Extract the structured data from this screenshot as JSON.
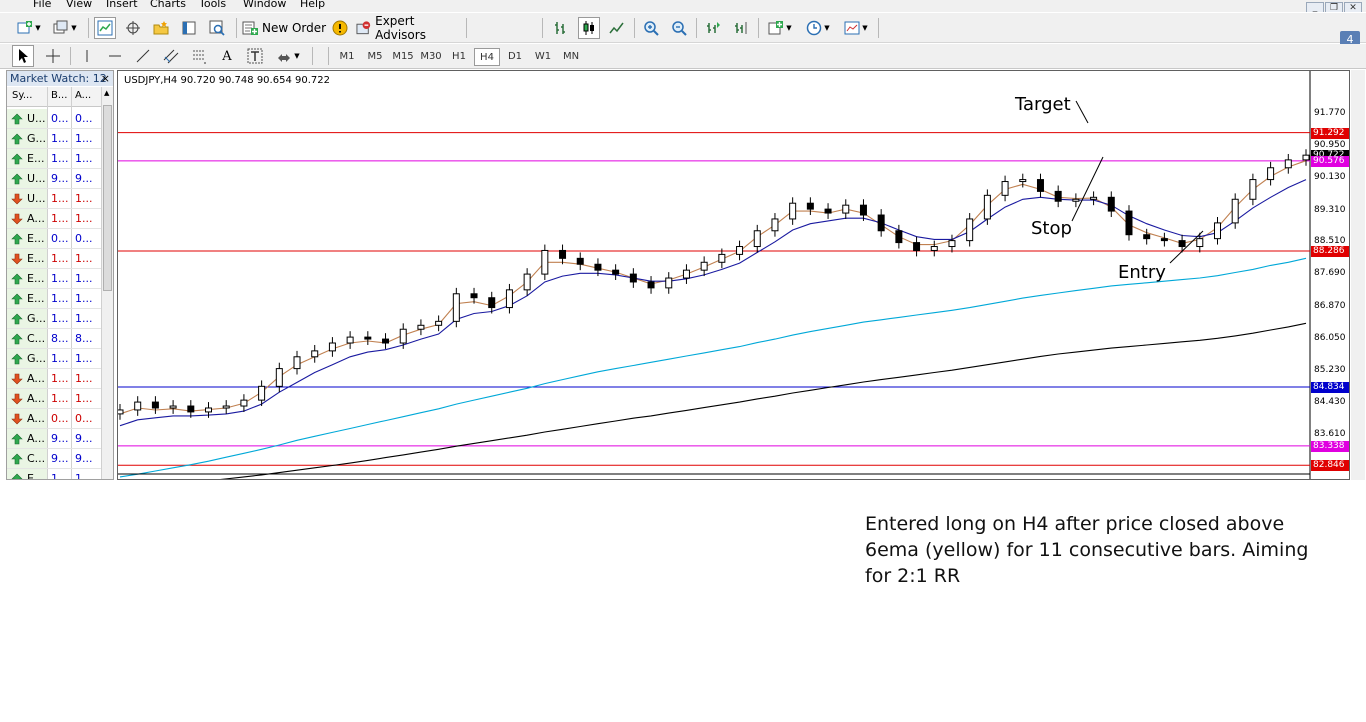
{
  "menu": [
    "File",
    "View",
    "Insert",
    "Charts",
    "Tools",
    "Window",
    "Help"
  ],
  "window_controls": [
    "_",
    "❐",
    "✕"
  ],
  "toolbar": {
    "new_order_label": "New Order",
    "expert_advisors_label": "Expert Advisors",
    "notification_count": "4"
  },
  "timeframes": [
    "M1",
    "M5",
    "M15",
    "M30",
    "H1",
    "H4",
    "D1",
    "W1",
    "MN"
  ],
  "active_timeframe": "H4",
  "market_watch": {
    "title": "Market Watch: 12",
    "close": "×",
    "columns": [
      "Sy...",
      "B...",
      "A..."
    ],
    "rows": [
      {
        "dir": "up",
        "symbol": "U...",
        "bid": "0...",
        "ask": "0...",
        "color": "#0000cc"
      },
      {
        "dir": "up",
        "symbol": "G...",
        "bid": "1...",
        "ask": "1...",
        "color": "#0000cc"
      },
      {
        "dir": "up",
        "symbol": "E...",
        "bid": "1...",
        "ask": "1...",
        "color": "#0000cc"
      },
      {
        "dir": "up",
        "symbol": "U...",
        "bid": "9...",
        "ask": "9...",
        "color": "#0000cc"
      },
      {
        "dir": "down",
        "symbol": "U...",
        "bid": "1...",
        "ask": "1...",
        "color": "#cc0000"
      },
      {
        "dir": "down",
        "symbol": "A...",
        "bid": "1...",
        "ask": "1...",
        "color": "#cc0000"
      },
      {
        "dir": "up",
        "symbol": "E...",
        "bid": "0...",
        "ask": "0...",
        "color": "#0000cc"
      },
      {
        "dir": "down",
        "symbol": "E...",
        "bid": "1...",
        "ask": "1...",
        "color": "#cc0000"
      },
      {
        "dir": "up",
        "symbol": "E...",
        "bid": "1...",
        "ask": "1...",
        "color": "#0000cc"
      },
      {
        "dir": "up",
        "symbol": "E...",
        "bid": "1...",
        "ask": "1...",
        "color": "#0000cc"
      },
      {
        "dir": "up",
        "symbol": "G...",
        "bid": "1...",
        "ask": "1...",
        "color": "#0000cc"
      },
      {
        "dir": "up",
        "symbol": "C...",
        "bid": "8...",
        "ask": "8...",
        "color": "#0000cc"
      },
      {
        "dir": "up",
        "symbol": "G...",
        "bid": "1...",
        "ask": "1...",
        "color": "#0000cc"
      },
      {
        "dir": "down",
        "symbol": "A...",
        "bid": "1...",
        "ask": "1...",
        "color": "#cc0000"
      },
      {
        "dir": "down",
        "symbol": "A...",
        "bid": "1...",
        "ask": "1...",
        "color": "#cc0000"
      },
      {
        "dir": "down",
        "symbol": "A...",
        "bid": "0...",
        "ask": "0...",
        "color": "#cc0000"
      },
      {
        "dir": "up",
        "symbol": "A...",
        "bid": "9...",
        "ask": "9...",
        "color": "#0000cc"
      },
      {
        "dir": "up",
        "symbol": "C...",
        "bid": "9...",
        "ask": "9...",
        "color": "#0000cc"
      },
      {
        "dir": "up",
        "symbol": "E...",
        "bid": "1...",
        "ask": "1...",
        "color": "#0000cc"
      }
    ]
  },
  "chart": {
    "header": "USDJPY,H4  90.720 90.748 90.654 90.722",
    "y_ticks": [
      "91.770",
      "90.950",
      "90.130",
      "89.310",
      "88.510",
      "87.690",
      "86.870",
      "86.050",
      "85.230",
      "84.430",
      "83.610"
    ],
    "price_labels": [
      {
        "value": "91.292",
        "color": "#e00000"
      },
      {
        "value": "90.722",
        "color": "#000000"
      },
      {
        "value": "90.576",
        "color": "#e000e0"
      },
      {
        "value": "88.286",
        "color": "#e00000"
      },
      {
        "value": "84.834",
        "color": "#0000cc"
      },
      {
        "value": "83.338",
        "color": "#e000e0"
      },
      {
        "value": "82.846",
        "color": "#e00000"
      }
    ],
    "annotations": {
      "target": "Target",
      "stop": "Stop",
      "entry": "Entry"
    }
  },
  "chart_data": {
    "type": "line",
    "title": "USDJPY,H4",
    "ylim": [
      82.7,
      92.4
    ],
    "series": [
      {
        "values": [
          84.25,
          84.45,
          84.3,
          84.35,
          84.2,
          84.3,
          84.35,
          84.5,
          84.85,
          85.3,
          85.6,
          85.75,
          85.95,
          86.1,
          86.05,
          85.95,
          86.3,
          86.4,
          86.5,
          87.2,
          87.1,
          86.85,
          87.3,
          87.7,
          88.3,
          88.1,
          87.95,
          87.8,
          87.7,
          87.5,
          87.35,
          87.6,
          87.8,
          88.0,
          88.2,
          88.4,
          88.8,
          89.1,
          89.5,
          89.35,
          89.25,
          89.45,
          89.2,
          88.8,
          88.5,
          88.3,
          88.4,
          88.55,
          89.1,
          89.7,
          90.05,
          90.1,
          89.8,
          89.55,
          89.6,
          89.65,
          89.3,
          88.7,
          88.6,
          88.55,
          88.4,
          88.6,
          89.0,
          89.6,
          90.1,
          90.4,
          90.6,
          90.72
        ]
      },
      {
        "values": [
          84.15,
          84.3,
          84.25,
          84.28,
          84.22,
          84.26,
          84.3,
          84.42,
          84.7,
          85.1,
          85.4,
          85.6,
          85.8,
          85.95,
          86.0,
          85.95,
          86.15,
          86.3,
          86.42,
          86.95,
          87.0,
          86.9,
          87.15,
          87.5,
          88.0,
          88.0,
          87.95,
          87.85,
          87.75,
          87.6,
          87.45,
          87.55,
          87.7,
          87.88,
          88.08,
          88.28,
          88.65,
          88.95,
          89.3,
          89.3,
          89.25,
          89.35,
          89.25,
          88.95,
          88.65,
          88.45,
          88.45,
          88.55,
          88.95,
          89.45,
          89.85,
          89.98,
          89.85,
          89.65,
          89.62,
          89.63,
          89.4,
          88.95,
          88.75,
          88.62,
          88.48,
          88.58,
          88.88,
          89.4,
          89.85,
          90.18,
          90.42,
          90.58
        ]
      },
      {
        "values": [
          83.85,
          84.0,
          84.05,
          84.1,
          84.1,
          84.12,
          84.15,
          84.22,
          84.4,
          84.7,
          84.95,
          85.2,
          85.4,
          85.6,
          85.72,
          85.78,
          85.9,
          86.05,
          86.18,
          86.55,
          86.7,
          86.75,
          86.9,
          87.15,
          87.5,
          87.65,
          87.72,
          87.72,
          87.68,
          87.6,
          87.52,
          87.52,
          87.58,
          87.68,
          87.82,
          87.98,
          88.25,
          88.52,
          88.82,
          88.98,
          89.05,
          89.12,
          89.12,
          89.0,
          88.82,
          88.65,
          88.58,
          88.58,
          88.78,
          89.1,
          89.4,
          89.6,
          89.65,
          89.6,
          89.58,
          89.58,
          89.45,
          89.18,
          88.98,
          88.82,
          88.68,
          88.65,
          88.75,
          89.05,
          89.38,
          89.65,
          89.9,
          90.1
        ]
      },
      {
        "values": [
          82.55,
          82.62,
          82.7,
          82.78,
          82.86,
          82.95,
          83.05,
          83.15,
          83.25,
          83.36,
          83.48,
          83.58,
          83.68,
          83.78,
          83.88,
          83.98,
          84.08,
          84.18,
          84.28,
          84.4,
          84.5,
          84.6,
          84.7,
          84.8,
          84.92,
          85.02,
          85.12,
          85.22,
          85.3,
          85.38,
          85.46,
          85.54,
          85.62,
          85.7,
          85.78,
          85.86,
          85.96,
          86.05,
          86.15,
          86.24,
          86.32,
          86.4,
          86.48,
          86.54,
          86.6,
          86.66,
          86.72,
          86.78,
          86.85,
          86.93,
          87.01,
          87.09,
          87.16,
          87.22,
          87.28,
          87.34,
          87.4,
          87.44,
          87.48,
          87.52,
          87.56,
          87.6,
          87.66,
          87.74,
          87.82,
          87.92,
          88.0,
          88.1
        ]
      },
      {
        "values": [
          82.2,
          82.25,
          82.3,
          82.35,
          82.4,
          82.45,
          82.5,
          82.55,
          82.6,
          82.66,
          82.72,
          82.78,
          82.84,
          82.9,
          82.97,
          83.04,
          83.11,
          83.18,
          83.25,
          83.33,
          83.4,
          83.47,
          83.54,
          83.61,
          83.69,
          83.76,
          83.83,
          83.9,
          83.97,
          84.04,
          84.1,
          84.17,
          84.24,
          84.31,
          84.38,
          84.45,
          84.53,
          84.6,
          84.68,
          84.75,
          84.82,
          84.89,
          84.96,
          85.02,
          85.08,
          85.14,
          85.2,
          85.26,
          85.33,
          85.4,
          85.47,
          85.54,
          85.61,
          85.67,
          85.72,
          85.77,
          85.82,
          85.86,
          85.9,
          85.94,
          85.98,
          86.02,
          86.07,
          86.13,
          86.2,
          86.28,
          86.36,
          86.45
        ]
      }
    ],
    "hlines": [
      91.292,
      90.576,
      88.286,
      84.834,
      83.338,
      82.846
    ]
  },
  "colors": {
    "ema_fast": "#e0a000",
    "ema_mid": "#c08050",
    "ema_slow": "#1a1aa0",
    "ma_cyan": "#00a8d8",
    "ma_black": "#000000"
  },
  "caption": {
    "line1": "Entered long on H4 after price closed above",
    "line2": "6ema (yellow) for 11 consecutive bars. Aiming",
    "line3": "for 2:1 RR"
  }
}
